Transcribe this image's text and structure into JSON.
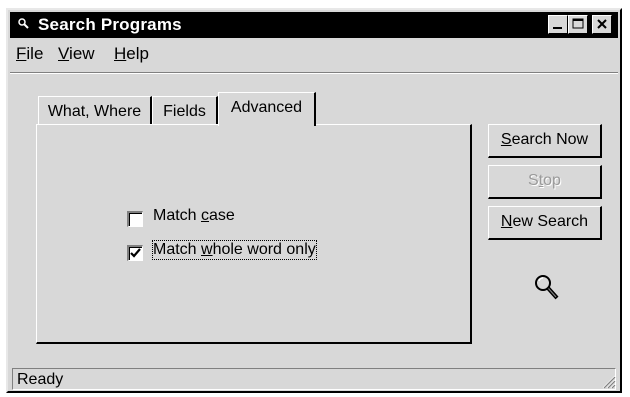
{
  "window": {
    "title": "Search Programs",
    "app_icon": "search-app-icon",
    "controls": [
      "minimize-icon",
      "maximize-icon",
      "close-icon"
    ]
  },
  "menu": {
    "file": {
      "pre": "",
      "key": "F",
      "post": "ile"
    },
    "view": {
      "pre": "",
      "key": "V",
      "post": "iew"
    },
    "help": {
      "pre": "",
      "key": "H",
      "post": "elp"
    }
  },
  "tabs": [
    {
      "label": "What, Where",
      "active": false
    },
    {
      "label": "Fields",
      "active": false
    },
    {
      "label": "Advanced",
      "active": true
    }
  ],
  "options": {
    "match_case": {
      "pre": "Match ",
      "key": "c",
      "post": "ase",
      "checked": false
    },
    "match_whole_word": {
      "pre": "Match ",
      "key": "w",
      "post": "hole word only",
      "checked": true
    }
  },
  "buttons": {
    "search_now": {
      "pre": "",
      "key": "S",
      "post": "earch Now",
      "enabled": true
    },
    "stop": {
      "pre": "S",
      "key": "t",
      "post": "op",
      "enabled": false
    },
    "new_search": {
      "pre": "",
      "key": "N",
      "post": "ew Search",
      "enabled": true
    }
  },
  "status": {
    "text": "Ready"
  },
  "colors": {
    "face": "#d8d8d8",
    "titlebar": "#000000",
    "title_text": "#ffffff",
    "disabled_text": "#9a9a9a"
  },
  "icons": {
    "search_animation": "magnifier-icon",
    "resize": "size-grip-icon"
  }
}
